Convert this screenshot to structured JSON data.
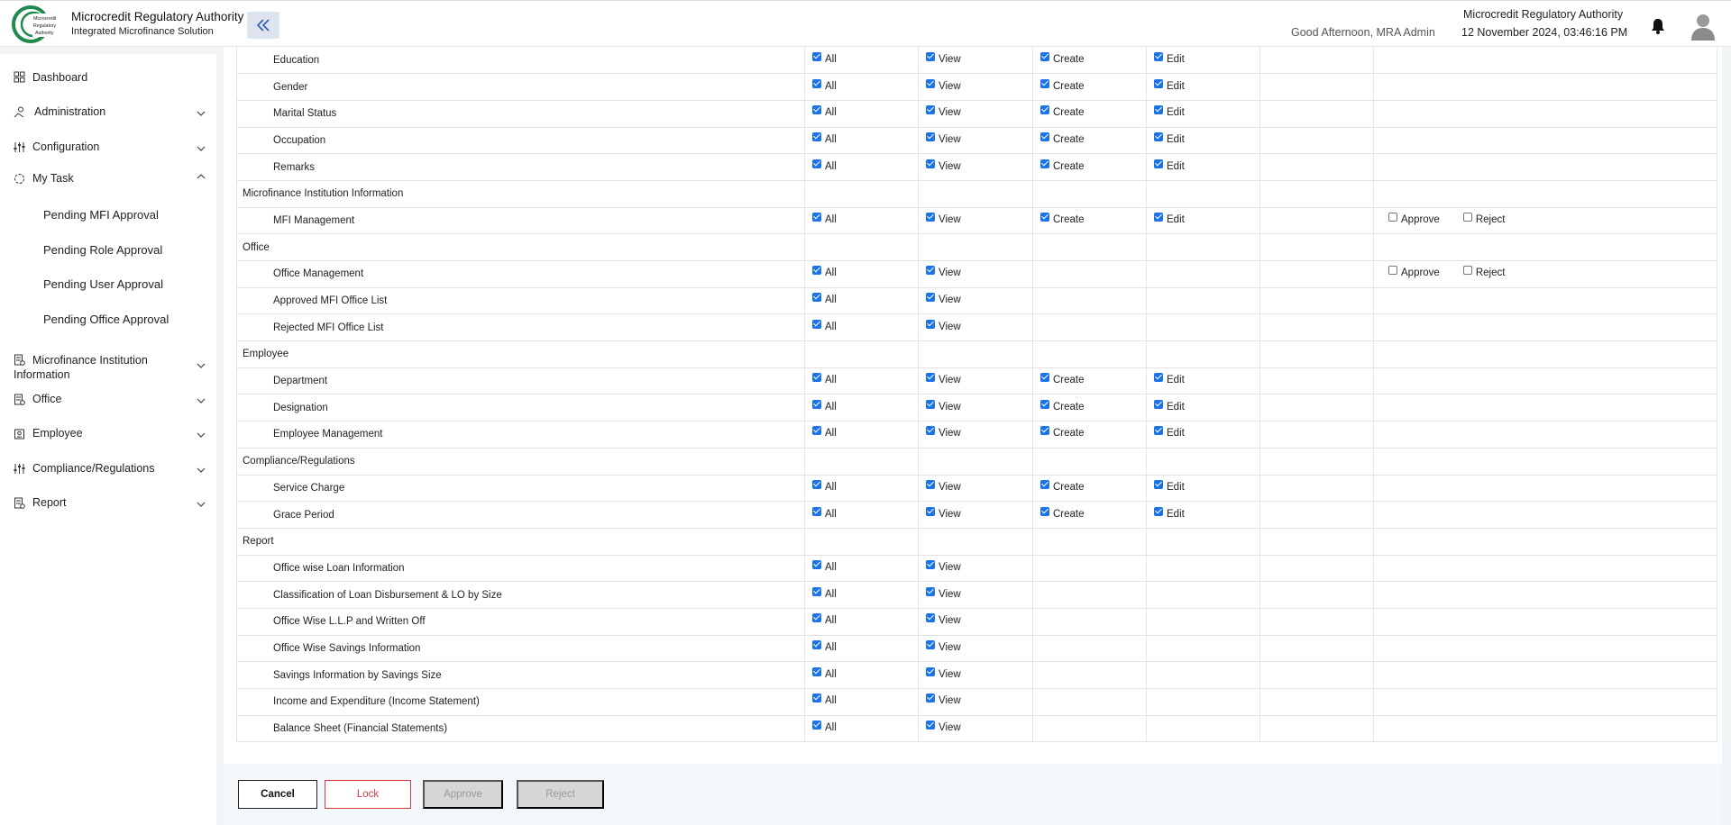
{
  "header": {
    "brand_title": "Microcredit Regulatory Authority",
    "brand_subtitle": "Integrated Microfinance Solution",
    "logo_text": "Microcredit Regulatory Authority",
    "greeting": "Good Afternoon, MRA Admin",
    "org_name": "Microcredit Regulatory Authority",
    "datetime": "12 November 2024, 03:46:16 PM"
  },
  "sidebar": {
    "items": [
      {
        "label": "Dashboard",
        "icon": "grid-icon"
      },
      {
        "label": "Administration",
        "icon": "admin-icon"
      },
      {
        "label": "Configuration",
        "icon": "sliders-icon"
      },
      {
        "label": "My Task",
        "icon": "task-icon"
      },
      {
        "label": "Microfinance Institution Information",
        "icon": "document-icon"
      },
      {
        "label": "Office",
        "icon": "document-icon"
      },
      {
        "label": "Employee",
        "icon": "employee-icon"
      },
      {
        "label": "Compliance/Regulations",
        "icon": "sliders-icon"
      },
      {
        "label": "Report",
        "icon": "document-icon"
      }
    ],
    "my_task_items": [
      "Pending MFI Approval",
      "Pending Role Approval",
      "Pending User Approval",
      "Pending Office Approval"
    ]
  },
  "labels": {
    "all": "All",
    "view": "View",
    "create": "Create",
    "edit": "Edit",
    "approve": "Approve",
    "reject": "Reject"
  },
  "rows": [
    {
      "type": "child",
      "name": "Education",
      "perms": [
        "all",
        "view",
        "create",
        "edit"
      ]
    },
    {
      "type": "child",
      "name": "Gender",
      "perms": [
        "all",
        "view",
        "create",
        "edit"
      ]
    },
    {
      "type": "child",
      "name": "Marital Status",
      "perms": [
        "all",
        "view",
        "create",
        "edit"
      ]
    },
    {
      "type": "child",
      "name": "Occupation",
      "perms": [
        "all",
        "view",
        "create",
        "edit"
      ]
    },
    {
      "type": "child",
      "name": "Remarks",
      "perms": [
        "all",
        "view",
        "create",
        "edit"
      ]
    },
    {
      "type": "section",
      "name": "Microfinance Institution Information"
    },
    {
      "type": "child",
      "name": "MFI Management",
      "perms": [
        "all",
        "view",
        "create",
        "edit"
      ],
      "approval": true
    },
    {
      "type": "section",
      "name": "Office"
    },
    {
      "type": "child",
      "name": "Office Management",
      "perms": [
        "all",
        "view"
      ],
      "approval": true
    },
    {
      "type": "child",
      "name": "Approved MFI Office List",
      "perms": [
        "all",
        "view"
      ]
    },
    {
      "type": "child",
      "name": "Rejected MFI Office List",
      "perms": [
        "all",
        "view"
      ]
    },
    {
      "type": "section",
      "name": "Employee"
    },
    {
      "type": "child",
      "name": "Department",
      "perms": [
        "all",
        "view",
        "create",
        "edit"
      ]
    },
    {
      "type": "child",
      "name": "Designation",
      "perms": [
        "all",
        "view",
        "create",
        "edit"
      ]
    },
    {
      "type": "child",
      "name": "Employee Management",
      "perms": [
        "all",
        "view",
        "create",
        "edit"
      ]
    },
    {
      "type": "section",
      "name": "Compliance/Regulations"
    },
    {
      "type": "child",
      "name": "Service Charge",
      "perms": [
        "all",
        "view",
        "create",
        "edit"
      ]
    },
    {
      "type": "child",
      "name": "Grace Period",
      "perms": [
        "all",
        "view",
        "create",
        "edit"
      ]
    },
    {
      "type": "section",
      "name": "Report"
    },
    {
      "type": "child",
      "name": "Office wise Loan Information",
      "perms": [
        "all",
        "view"
      ]
    },
    {
      "type": "child",
      "name": "Classification of Loan Disbursement & LO by Size",
      "perms": [
        "all",
        "view"
      ]
    },
    {
      "type": "child",
      "name": "Office Wise L.L.P and Written Off",
      "perms": [
        "all",
        "view"
      ]
    },
    {
      "type": "child",
      "name": "Office Wise Savings Information",
      "perms": [
        "all",
        "view"
      ]
    },
    {
      "type": "child",
      "name": "Savings Information by Savings Size",
      "perms": [
        "all",
        "view"
      ]
    },
    {
      "type": "child",
      "name": "Income and Expenditure (Income Statement)",
      "perms": [
        "all",
        "view"
      ]
    },
    {
      "type": "child",
      "name": "Balance Sheet (Financial Statements)",
      "perms": [
        "all",
        "view"
      ]
    }
  ],
  "footer": {
    "cancel_label": "Cancel",
    "lock_label": "Lock",
    "approve_label": "Approve",
    "reject_label": "Reject"
  },
  "colors": {
    "accent": "#1a73e8",
    "danger": "#d9363e",
    "disabled_bg": "#d6d6d6",
    "logo_green": "#1f8a4c"
  }
}
